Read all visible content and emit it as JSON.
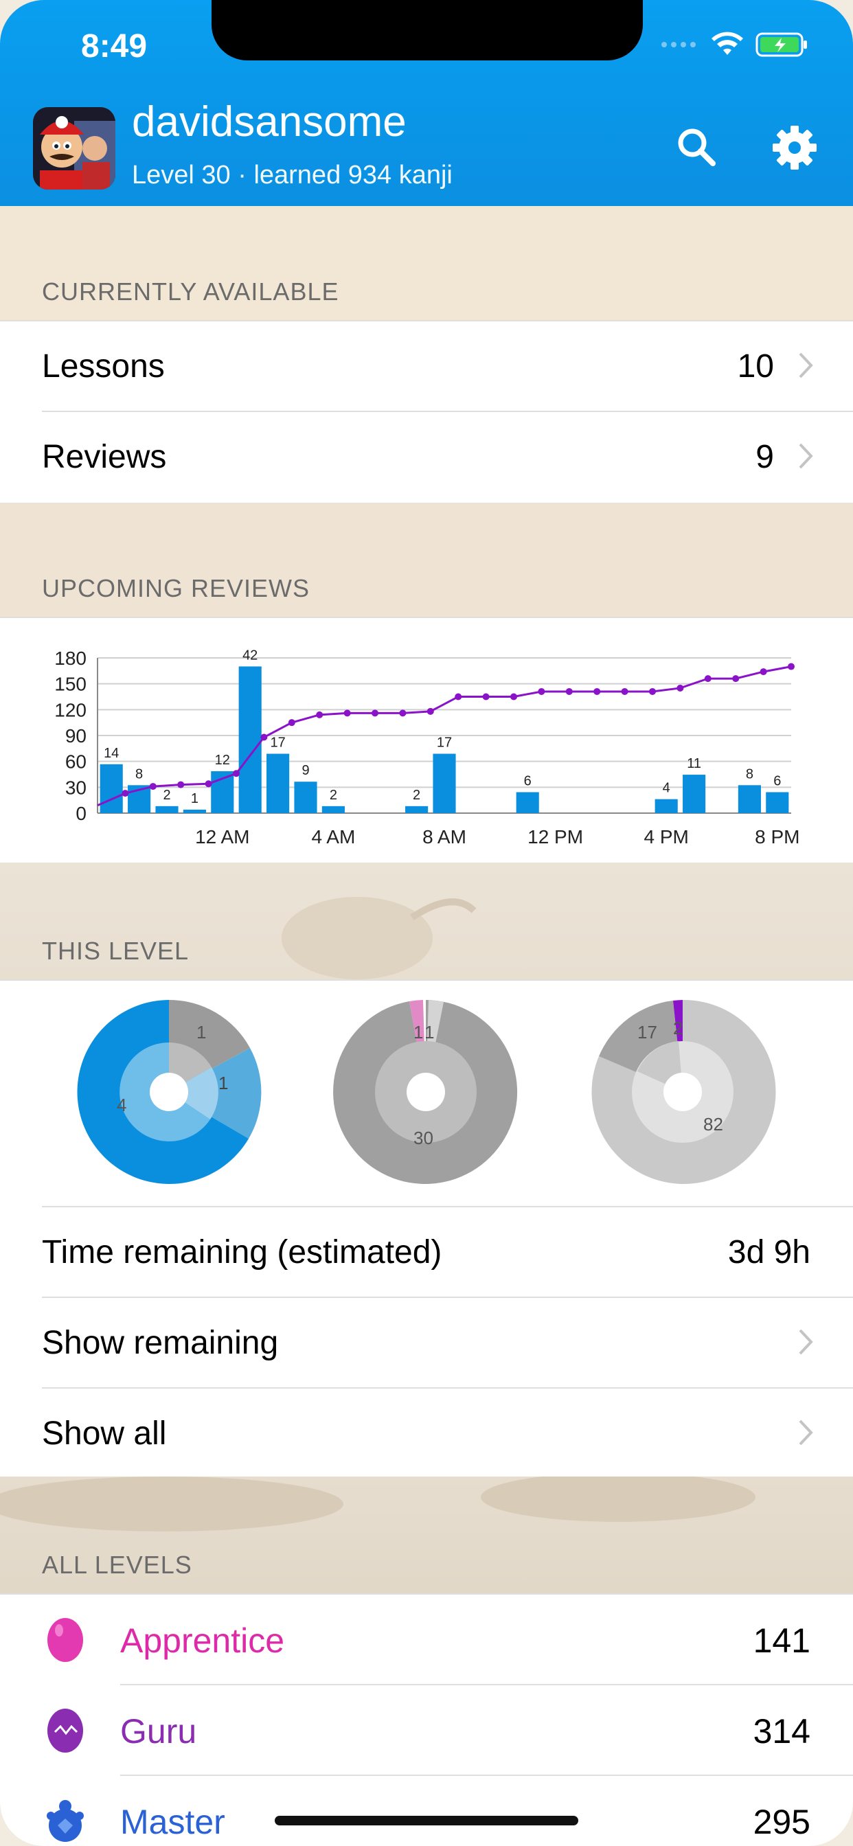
{
  "status": {
    "time": "8:49"
  },
  "header": {
    "username": "davidsansome",
    "subtitle": "Level 30 · learned 934 kanji"
  },
  "currently_available": {
    "title": "CURRENTLY AVAILABLE",
    "rows": [
      {
        "label": "Lessons",
        "value": "10"
      },
      {
        "label": "Reviews",
        "value": "9"
      }
    ]
  },
  "upcoming_reviews": {
    "title": "UPCOMING REVIEWS"
  },
  "chart_data": {
    "type": "bar",
    "y_ticks": [
      "180",
      "150",
      "120",
      "90",
      "60",
      "30",
      "0"
    ],
    "ylim": [
      0,
      180
    ],
    "x_tick_labels": [
      "12 AM",
      "4 AM",
      "8 AM",
      "12 PM",
      "4 PM",
      "8 PM"
    ],
    "values": [
      14,
      8,
      2,
      1,
      12,
      42,
      17,
      9,
      2,
      0,
      0,
      2,
      17,
      0,
      0,
      6,
      0,
      0,
      0,
      0,
      4,
      11,
      0,
      8,
      6
    ],
    "bar_labels": [
      "14",
      "8",
      "2",
      "1",
      "12",
      "42",
      "17",
      "9",
      "2",
      "",
      "",
      "2",
      "17",
      "",
      "",
      "6",
      "",
      "",
      "",
      "",
      "4",
      "11",
      "",
      "8",
      "6"
    ],
    "cumulative": [
      9,
      23,
      31,
      33,
      34,
      46,
      88,
      105,
      114,
      116,
      116,
      116,
      118,
      135,
      135,
      135,
      141,
      141,
      141,
      141,
      141,
      145,
      156,
      156,
      164,
      170
    ],
    "bar_color": "#0a8fde",
    "line_color": "#8a12c8"
  },
  "this_level": {
    "title": "THIS LEVEL",
    "donuts": [
      {
        "labels": [
          "1",
          "1",
          "4"
        ]
      },
      {
        "labels": [
          "1",
          "1",
          "30"
        ]
      },
      {
        "labels": [
          "17",
          "2",
          "82"
        ]
      }
    ],
    "rows": [
      {
        "label": "Time remaining (estimated)",
        "value": "3d 9h"
      },
      {
        "label": "Show remaining"
      },
      {
        "label": "Show all"
      }
    ]
  },
  "all_levels": {
    "title": "ALL LEVELS",
    "rows": [
      {
        "label": "Apprentice",
        "value": "141",
        "color": "#dd2aa8"
      },
      {
        "label": "Guru",
        "value": "314",
        "color": "#8a2db0"
      },
      {
        "label": "Master",
        "value": "295",
        "color": "#2a62d6"
      }
    ]
  }
}
